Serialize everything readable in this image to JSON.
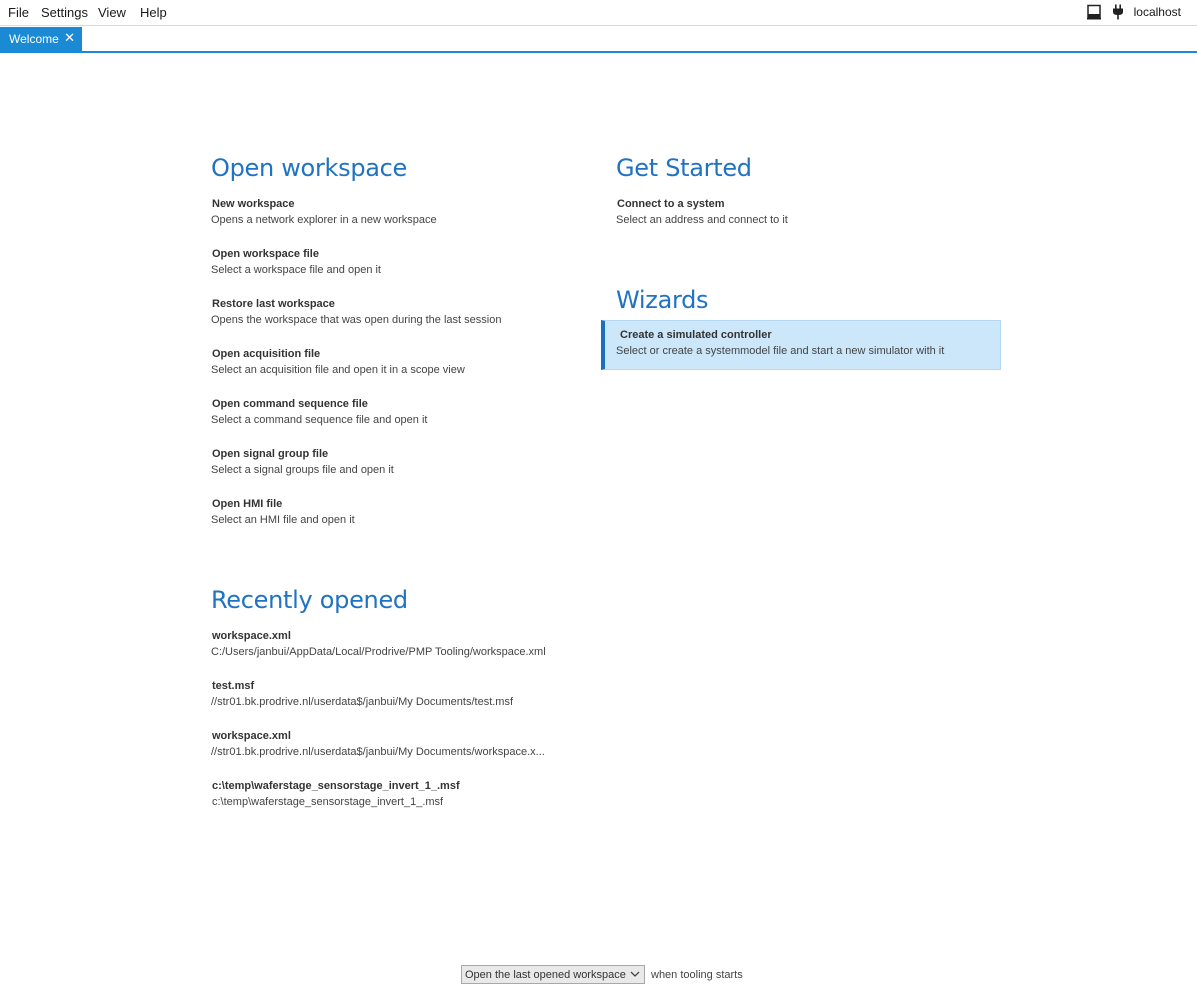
{
  "menu": {
    "file": "File",
    "settings": "Settings",
    "view": "View",
    "help": "Help"
  },
  "connection": {
    "host": "localhost"
  },
  "tabs": [
    {
      "label": "Welcome"
    }
  ],
  "open_workspace": {
    "title": "Open workspace",
    "items": [
      {
        "title": "New workspace",
        "desc": "Opens a network explorer in a new workspace"
      },
      {
        "title": "Open workspace file",
        "desc": "Select a workspace file and open it"
      },
      {
        "title": "Restore last workspace",
        "desc": "Opens the workspace that was open during the last session"
      },
      {
        "title": "Open acquisition file",
        "desc": "Select an acquisition file and open it in a scope view"
      },
      {
        "title": "Open command sequence file",
        "desc": "Select a command sequence file and open it"
      },
      {
        "title": "Open signal group file",
        "desc": "Select a signal groups file and open it"
      },
      {
        "title": "Open HMI file",
        "desc": "Select an HMI file and open it"
      }
    ]
  },
  "get_started": {
    "title": "Get Started",
    "items": [
      {
        "title": "Connect to a system",
        "desc": "Select an address and connect to it"
      }
    ]
  },
  "wizards": {
    "title": "Wizards",
    "items": [
      {
        "title": "Create a simulated controller",
        "desc": "Select or create a systemmodel file and start a new simulator with it"
      }
    ]
  },
  "recent": {
    "title": "Recently opened",
    "items": [
      {
        "title": "workspace.xml",
        "path": "C:/Users/janbui/AppData/Local/Prodrive/PMP Tooling/workspace.xml"
      },
      {
        "title": "test.msf",
        "path": "//str01.bk.prodrive.nl/userdata$/janbui/My Documents/test.msf"
      },
      {
        "title": "workspace.xml",
        "path": "//str01.bk.prodrive.nl/userdata$/janbui/My Documents/workspace.x..."
      },
      {
        "title": "c:\\temp\\waferstage_sensorstage_invert_1_.msf",
        "path": "c:\\temp\\waferstage_sensorstage_invert_1_.msf"
      }
    ]
  },
  "footer": {
    "startup_option": "Open the last opened workspace",
    "suffix": "when tooling starts"
  },
  "colors": {
    "accent": "#1a8ad4",
    "heading": "#1f73c2",
    "wizard_bg": "#cce6fa"
  }
}
